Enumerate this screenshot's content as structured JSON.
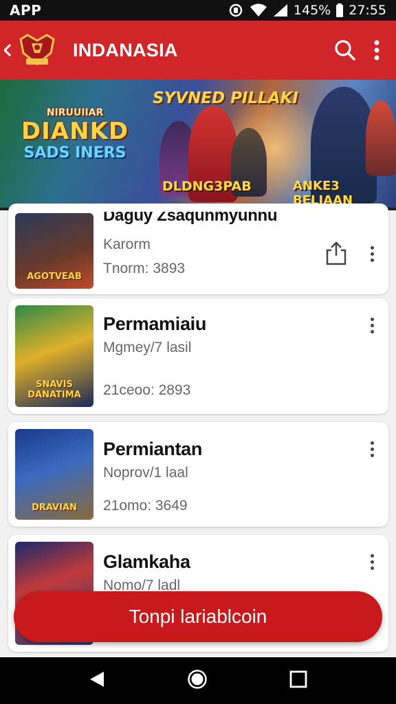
{
  "status_bar": {
    "app_label": "APP",
    "battery": "145%",
    "time": "27:55",
    "icons": [
      "sync-icon",
      "wifi-icon",
      "signal-icon"
    ]
  },
  "app_bar": {
    "title": "INDANASIA",
    "icons": [
      "back-icon",
      "logo",
      "search-icon",
      "more-vert-icon"
    ],
    "color": "#d0262a"
  },
  "banner": {
    "top_text": "SYVNED PILLAKI",
    "title_small": "NIRUUIIAR",
    "title_main": "DIANKD",
    "title_sub": "SADS INERS",
    "bottom_left": "DLDNG3PAB",
    "bottom_right": "ANKE3 BELIAAN"
  },
  "items": [
    {
      "title": "Daguy Zsaqunmyunnu",
      "subtitle": "Karorm",
      "meta": "Tnorm: 3893",
      "thumb_text": "AGOTVEAB",
      "has_share": true
    },
    {
      "title": "Permamiaiu",
      "subtitle": "Mgmey/7 lasil",
      "meta": "21ceoo: 2893",
      "thumb_text": "SNAVIS DANATIMA",
      "has_share": false
    },
    {
      "title": "Permiantan",
      "subtitle": "Noprov/1 laal",
      "meta": "21omo: 3649",
      "thumb_text": "DRAVIAN",
      "has_share": false
    },
    {
      "title": "Glamkaha",
      "subtitle": "Nomo/7 ladl",
      "meta": "",
      "thumb_text": "",
      "has_share": false
    }
  ],
  "fab": {
    "label": "Tonpi lariablcoin",
    "color": "#c8191d"
  },
  "nav_bar": {
    "icons": [
      "back-triangle-icon",
      "home-circle-icon",
      "recents-square-icon"
    ]
  }
}
